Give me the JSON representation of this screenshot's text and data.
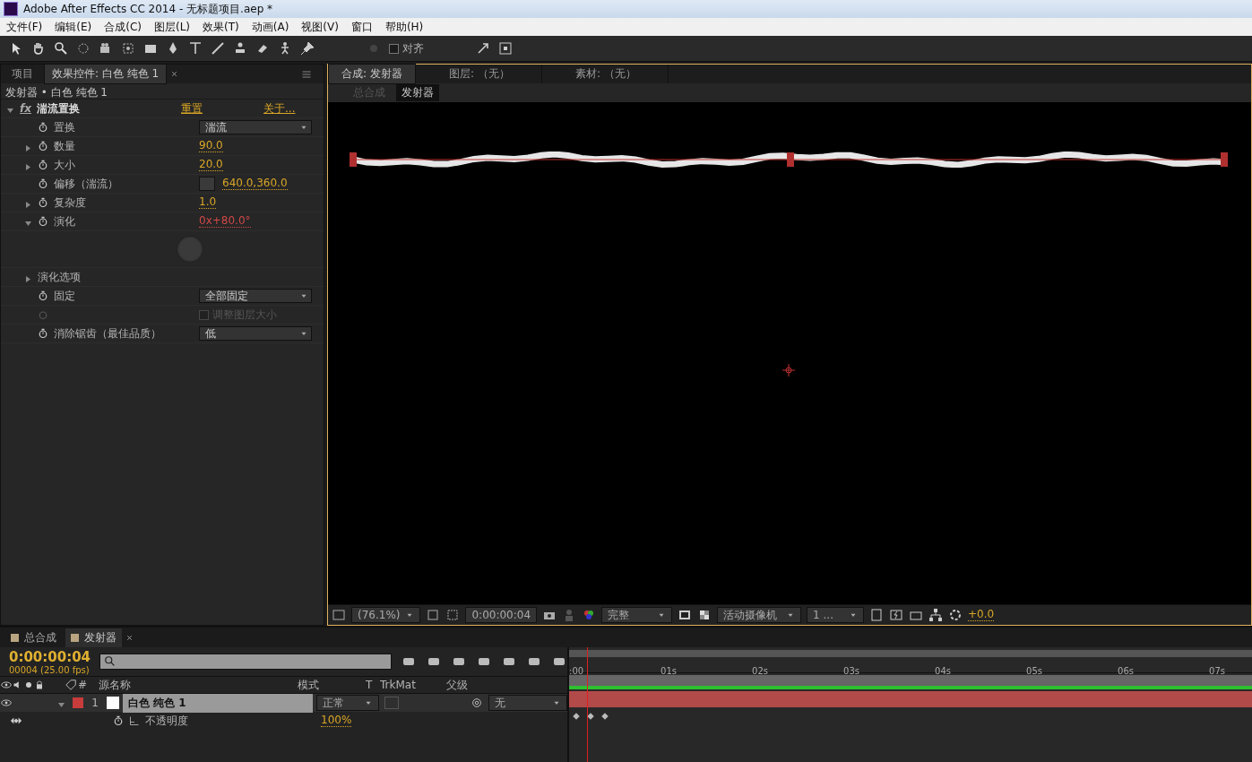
{
  "window": {
    "title": "Adobe After Effects CC 2014 - 无标题项目.aep *"
  },
  "menu": [
    "文件(F)",
    "编辑(E)",
    "合成(C)",
    "图层(L)",
    "效果(T)",
    "动画(A)",
    "视图(V)",
    "窗口",
    "帮助(H)"
  ],
  "toolbar": {
    "snap": {
      "label": "对齐",
      "checked": false
    }
  },
  "left_panel": {
    "tabs": [
      {
        "label": "项目",
        "selected": false
      },
      {
        "label": "效果控件: 白色 纯色 1",
        "selected": true
      }
    ],
    "breadcrumb": "发射器 • 白色 纯色 1",
    "effect": {
      "fx": "fx",
      "name": "湍流置换",
      "expanded": true,
      "reset": "重置",
      "about": "关于...",
      "properties": [
        {
          "kind": "dropdown",
          "label": "置换",
          "value": "湍流"
        },
        {
          "kind": "value",
          "label": "数量",
          "value": "90.0",
          "expanded": false
        },
        {
          "kind": "value",
          "label": "大小",
          "value": "20.0",
          "expanded": false
        },
        {
          "kind": "point",
          "label": "偏移（湍流）",
          "value": "640.0,360.0"
        },
        {
          "kind": "value",
          "label": "复杂度",
          "value": "1.0",
          "expanded": false
        },
        {
          "kind": "angle",
          "label": "演化",
          "value": "0x+80.0°",
          "expanded": true
        },
        {
          "kind": "group",
          "label": "演化选项",
          "expanded": false
        },
        {
          "kind": "dropdown",
          "label": "固定",
          "value": "全部固定"
        },
        {
          "kind": "checkbox",
          "label": "调整图层大小",
          "checked": false,
          "disabled": true
        },
        {
          "kind": "dropdown",
          "label": "消除锯齿（最佳品质）",
          "value": "低"
        }
      ]
    }
  },
  "comp_panel": {
    "tabs": [
      {
        "label": "合成: 发射器",
        "selected": true
      },
      {
        "label": "图层: （无）",
        "selected": false
      },
      {
        "label": "素材: （无）",
        "selected": false
      }
    ],
    "breadcrumbs": [
      {
        "label": "总合成",
        "selected": false
      },
      {
        "label": "发射器",
        "selected": true
      }
    ],
    "footer": {
      "zoom": "(76.1%)",
      "timecode": "0:00:00:04",
      "resolution": "完整",
      "camera": "活动摄像机",
      "views": "1 ...",
      "exposure": "+0.0"
    }
  },
  "timeline": {
    "tabs": [
      {
        "label": "总合成",
        "selected": false
      },
      {
        "label": "发射器",
        "selected": true
      }
    ],
    "timecode": "0:00:00:04",
    "frame_info": "00004 (25.00 fps)",
    "columns": [
      "#",
      "源名称",
      "模式",
      "T",
      "TrkMat",
      "父级"
    ],
    "layers": [
      {
        "number": "1",
        "name": "白色 纯色 1",
        "color": "#c83c3c",
        "expanded": true,
        "mode": "正常",
        "parent": "无",
        "properties": [
          {
            "name": "不透明度",
            "value": "100%"
          }
        ]
      }
    ],
    "ruler": [
      ":00",
      "01s",
      "02s",
      "03s",
      "04s",
      "05s",
      "06s",
      "07s"
    ]
  }
}
